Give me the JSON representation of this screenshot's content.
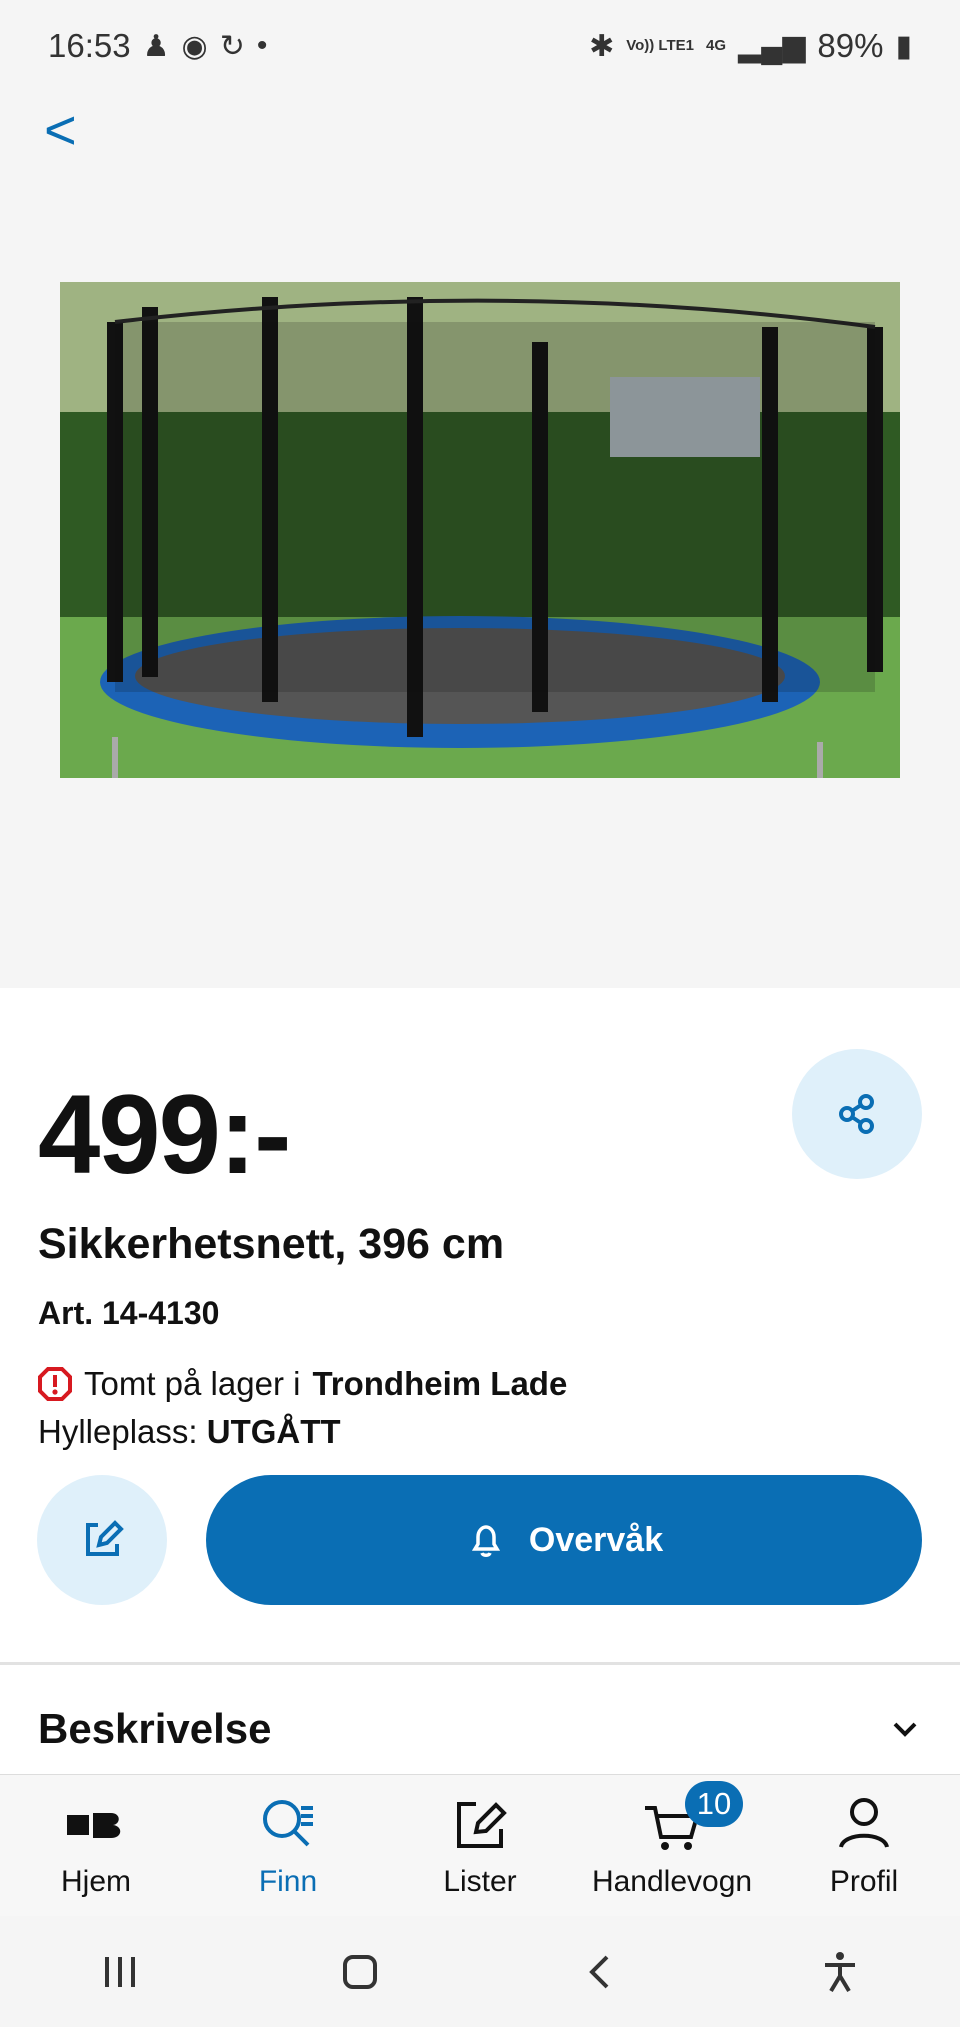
{
  "status_bar": {
    "time": "16:53",
    "network_text": "Vo)) LTE1",
    "signal_text": "4G",
    "battery": "89%"
  },
  "navigation": {
    "back_label": "<"
  },
  "product": {
    "image_alt": "Trampoline with safety net",
    "price": "499:-",
    "title": "Sikkerhetsnett, 396 cm",
    "article": "Art. 14-4130",
    "stock_prefix": "Tomt på lager i ",
    "store": "Trondheim Lade",
    "shelf_label": "Hylleplass: ",
    "shelf_value": "UTGÅTT"
  },
  "actions": {
    "watch_label": "Overvåk"
  },
  "description": {
    "title": "Beskrivelse"
  },
  "bottom_nav": {
    "home": "Hjem",
    "find": "Finn",
    "lists": "Lister",
    "cart": "Handlevogn",
    "cart_count": "10",
    "profile": "Profil"
  },
  "colors": {
    "brand_blue": "#0a6eb4",
    "light_blue": "#dff0fa",
    "alert_red": "#d71920"
  }
}
